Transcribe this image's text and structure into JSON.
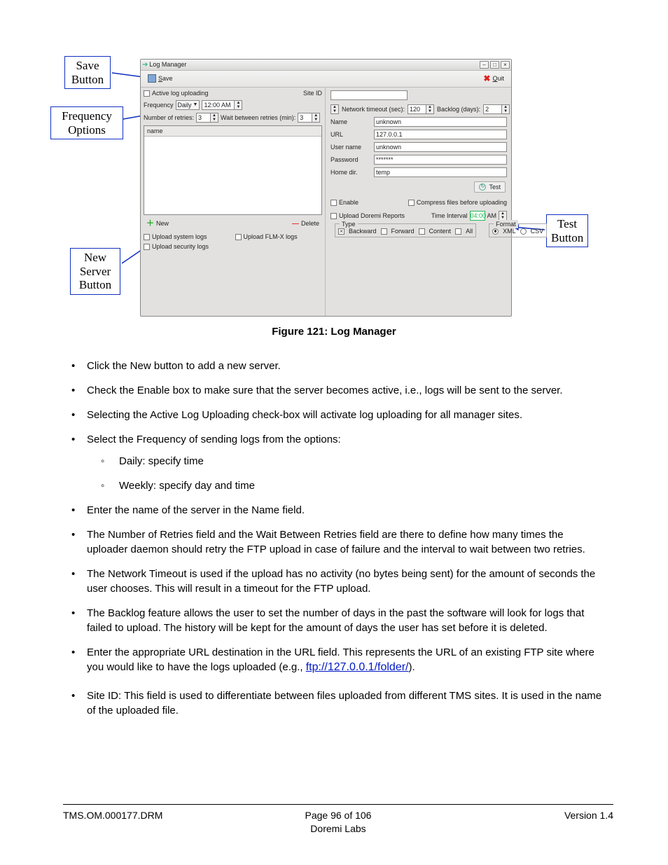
{
  "callouts": {
    "save": "Save\nButton",
    "freq": "Frequency\nOptions",
    "new": "New\nServer\nButton",
    "test": "Test\nButton"
  },
  "window": {
    "title": "Log Manager",
    "save": "Save",
    "quit": "Quit",
    "left": {
      "active_log": "Active log uploading",
      "site_id_lbl": "Site ID",
      "frequency_lbl": "Frequency",
      "frequency_val": "Daily",
      "time_val": "12:00 AM",
      "retries_lbl": "Number of retries:",
      "retries_val": "3",
      "wait_lbl": "Wait between retries (min):",
      "wait_val": "3",
      "list_hdr": "name",
      "new_btn": "New",
      "del_btn": "Delete",
      "u_sys": "Upload system logs",
      "u_flmx": "Upload FLM-X logs",
      "u_sec": "Upload security logs"
    },
    "right": {
      "net_timeout_lbl": "Network timeout (sec):",
      "net_timeout_val": "120",
      "backlog_lbl": "Backlog (days):",
      "backlog_val": "2",
      "name_lbl": "Name",
      "name_val": "unknown",
      "url_lbl": "URL",
      "url_val": "127.0.0.1",
      "user_lbl": "User name",
      "user_val": "unknown",
      "pass_lbl": "Password",
      "pass_val": "*******",
      "home_lbl": "Home dir.",
      "home_val": "temp",
      "test_btn": "Test",
      "enable_lbl": "Enable",
      "compress_lbl": "Compress files before uploading",
      "doremi_lbl": "Upload Doremi Reports",
      "time_int_lbl": "Time Interval",
      "time_int_val": "04:00",
      "time_int_ampm": "AM",
      "type_legend": "Type",
      "t_back": "Backward",
      "t_fwd": "Forward",
      "t_cont": "Content",
      "t_all": "All",
      "fmt_legend": "Format",
      "f_xml": "XML",
      "f_csv": "CSV"
    }
  },
  "caption": "Figure 121: Log Manager",
  "bullets": [
    "Click the New button to add a new server.",
    "Check the Enable box to make sure that the server becomes active, i.e., logs will be sent to the server.",
    "Selecting the Active Log Uploading check-box will activate log uploading for all manager sites.",
    "Select the Frequency of sending logs from the options:",
    "Enter the name of the server in the Name field.",
    "The Number of Retries field and the Wait Between Retries field are there to define how many times the uploader daemon should retry the FTP upload in case of failure and the interval to wait between two retries.",
    "The Network Timeout is used if the upload has no activity (no bytes being sent) for the amount of seconds the user chooses. This will result in a timeout for the FTP upload.",
    "The Backlog feature allows the user to set the number of days in the past the software will look for logs that failed to upload. The history will be kept for the amount of days the user has set before it is deleted.",
    "Site ID: This field is used to differentiate between files uploaded from different TMS sites. It is used in the name of the uploaded file."
  ],
  "freq_sub": [
    "Daily: specify time",
    "Weekly: specify day and time"
  ],
  "url_bullet_prefix": "Enter the appropriate URL destination in the URL field. This represents the URL of an existing FTP site where you would like to have the logs uploaded (e.g., ",
  "url_link": "ftp://127.0.0.1/folder/",
  "url_bullet_suffix": ").",
  "footer": {
    "left": "TMS.OM.000177.DRM",
    "center1": "Page 96 of 106",
    "center2": "Doremi Labs",
    "right": "Version 1.4"
  }
}
